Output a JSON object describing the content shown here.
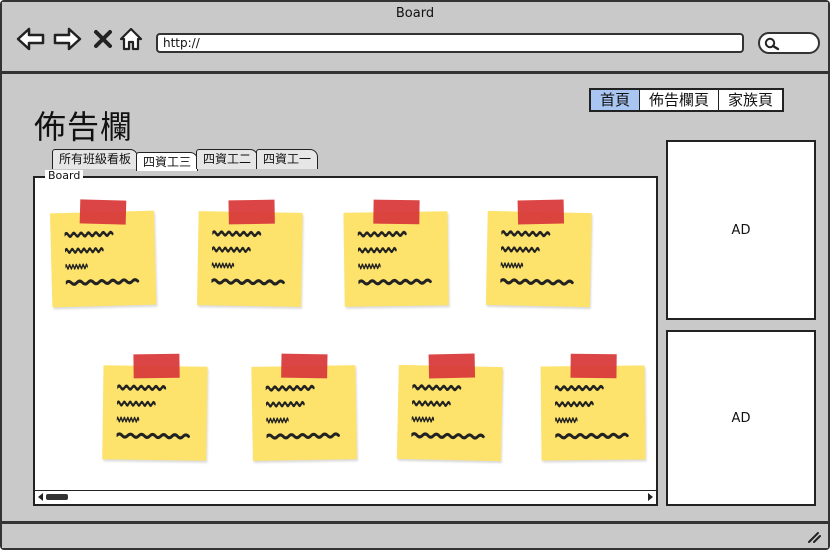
{
  "window": {
    "title": "Board"
  },
  "browser": {
    "url": "http://",
    "back_icon": "back-arrow-icon",
    "forward_icon": "forward-arrow-icon",
    "stop_icon": "close-icon",
    "home_icon": "home-icon",
    "search_icon": "search-icon"
  },
  "page": {
    "title": "佈告欄"
  },
  "topnav": {
    "items": [
      {
        "label": "首頁",
        "active": true
      },
      {
        "label": "佈告欄頁",
        "active": false
      },
      {
        "label": "家族頁",
        "active": false
      }
    ],
    "active_color": "#a9c6f2"
  },
  "tabs": [
    {
      "label": "所有班級看板",
      "active": false
    },
    {
      "label": "四資工三",
      "active": true
    },
    {
      "label": "四資工二",
      "active": false
    },
    {
      "label": "四資工一",
      "active": false
    }
  ],
  "board": {
    "legend": "Board",
    "note_count": 8,
    "note_color": "#fde36b",
    "tape_color": "#d93b3b"
  },
  "ads": [
    {
      "label": "AD"
    },
    {
      "label": "AD"
    }
  ]
}
